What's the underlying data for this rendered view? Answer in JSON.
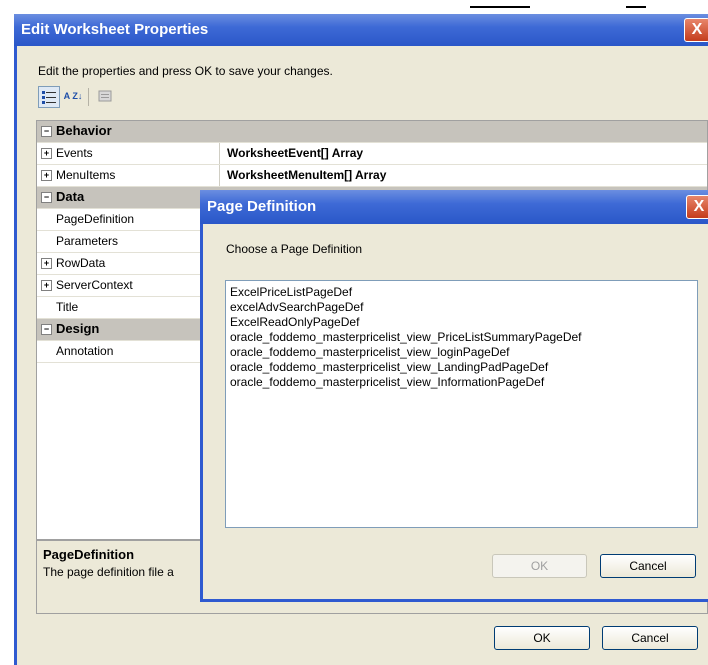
{
  "outer_dialog": {
    "title": "Edit Worksheet Properties",
    "close_glyph": "X",
    "instruction": "Edit the properties and press OK to save your changes.",
    "toolbar": {
      "categorized_icon": "categorized-icon",
      "alphabetical_icon": "alphabetical-icon",
      "alphabetical_glyph": "A Z↓",
      "property_pages_icon": "property-pages-icon"
    },
    "property_grid": {
      "rows": [
        {
          "kind": "category",
          "expander": "⊟",
          "name": "Behavior",
          "value": ""
        },
        {
          "kind": "property",
          "expander": "⊞",
          "name": "Events",
          "value": "WorksheetEvent[] Array"
        },
        {
          "kind": "property",
          "expander": "⊞",
          "name": "MenuItems",
          "value": "WorksheetMenuItem[] Array"
        },
        {
          "kind": "category",
          "expander": "⊟",
          "name": "Data",
          "value": ""
        },
        {
          "kind": "property",
          "expander": "",
          "name": "PageDefinition",
          "value": ""
        },
        {
          "kind": "property",
          "expander": "",
          "name": "Parameters",
          "value": ""
        },
        {
          "kind": "property",
          "expander": "⊞",
          "name": "RowData",
          "value": ""
        },
        {
          "kind": "property",
          "expander": "⊞",
          "name": "ServerContext",
          "value": ""
        },
        {
          "kind": "property",
          "expander": "",
          "name": "Title",
          "value": ""
        },
        {
          "kind": "category",
          "expander": "⊟",
          "name": "Design",
          "value": ""
        },
        {
          "kind": "property",
          "expander": "",
          "name": "Annotation",
          "value": ""
        }
      ]
    },
    "description": {
      "title": "PageDefinition",
      "text": "The page definition file a"
    },
    "ok_label": "OK",
    "cancel_label": "Cancel"
  },
  "inner_dialog": {
    "title": "Page Definition",
    "close_glyph": "X",
    "prompt": "Choose a Page Definition",
    "items": [
      "ExcelPriceListPageDef",
      "excelAdvSearchPageDef",
      "ExcelReadOnlyPageDef",
      "oracle_foddemo_masterpricelist_view_PriceListSummaryPageDef",
      "oracle_foddemo_masterpricelist_view_loginPageDef",
      "oracle_foddemo_masterpricelist_view_LandingPadPageDef",
      "oracle_foddemo_masterpricelist_view_InformationPageDef"
    ],
    "ok_label": "OK",
    "cancel_label": "Cancel"
  },
  "colors": {
    "title_bar": "#2a57c8",
    "dialog_face": "#ece9d8",
    "category_row": "#c6c3bc"
  }
}
